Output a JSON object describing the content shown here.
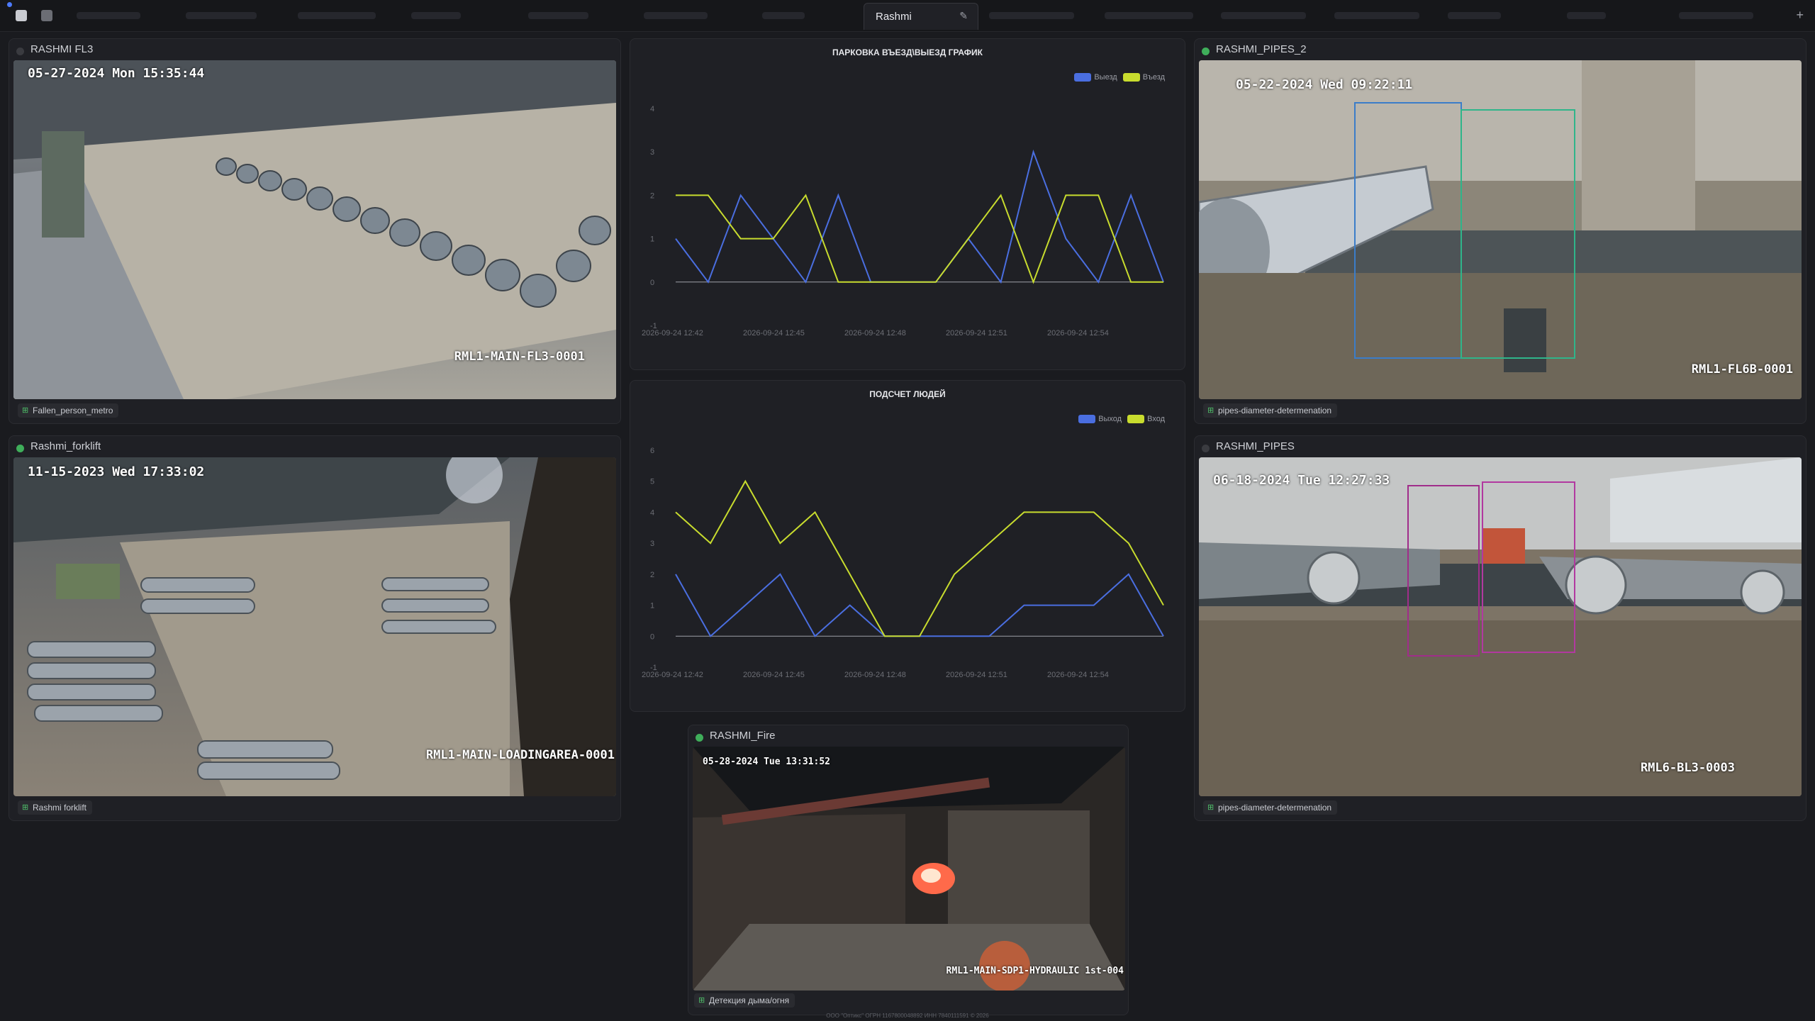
{
  "topbar": {
    "active_tab": "Rashmi"
  },
  "cameras": [
    {
      "title": "RASHMI FL3",
      "timestamp": "05-27-2024 Mon 15:35:44",
      "cam_id": "RML1-MAIN-FL3-0001",
      "tag": "Fallen_person_metro",
      "status": "offline",
      "status_color": "#3a3b40"
    },
    {
      "title": "Rashmi_forklift",
      "timestamp": "11-15-2023 Wed 17:33:02",
      "cam_id": "RML1-MAIN-LOADINGAREA-0001",
      "tag": "Rashmi forklift",
      "status": "online",
      "status_color": "#3fae5a"
    },
    {
      "title": "RASHMI_PIPES_2",
      "timestamp": "05-22-2024 Wed 09:22:11",
      "cam_id": "RML1-FL6B-0001",
      "tag": "pipes-diameter-determenation",
      "status": "online",
      "status_color": "#3fae5a"
    },
    {
      "title": "RASHMI_PIPES",
      "timestamp": "06-18-2024 Tue 12:27:33",
      "cam_id": "RML6-BL3-0003",
      "tag": "pipes-diameter-determenation",
      "status": "offline",
      "status_color": "#3a3b40"
    },
    {
      "title": "RASHMI_Fire",
      "timestamp": "05-28-2024 Tue 13:31:52",
      "cam_id": "RML1-MAIN-SDP1-HYDRAULIC 1st-004",
      "tag": "Детекция дыма/огня",
      "status": "online",
      "status_color": "#3fae5a"
    }
  ],
  "colors": {
    "blue": "#4a6ee0",
    "yellow": "#c8dc2e",
    "accent": "#4fbf6a"
  },
  "chart_data": [
    {
      "type": "line",
      "title": "ПАРКОВКА ВЪЕЗД\\ВЫЕЗД ГРАФИК",
      "x": [
        "2026-09-24 12:41",
        "2026-09-24 12:42",
        "2026-09-24 12:43",
        "2026-09-24 12:44",
        "2026-09-24 12:45",
        "2026-09-24 12:46",
        "2026-09-24 12:47",
        "2026-09-24 12:48",
        "2026-09-24 12:49",
        "2026-09-24 12:50",
        "2026-09-24 12:51",
        "2026-09-24 12:52",
        "2026-09-24 12:53",
        "2026-09-24 12:54",
        "2026-09-24 12:55"
      ],
      "tick_labels": [
        "2026-09-24 12:42",
        "2026-09-24 12:45",
        "2026-09-24 12:48",
        "2026-09-24 12:51",
        "2026-09-24 12:54"
      ],
      "ylim": [
        -1,
        4
      ],
      "yticks": [
        -1,
        0,
        1,
        2,
        3,
        4
      ],
      "series": [
        {
          "name": "Выезд",
          "color": "#4a6ee0",
          "values": [
            1,
            0,
            2,
            1,
            0,
            2,
            0,
            0,
            0,
            1,
            0,
            3,
            1,
            0,
            2,
            0
          ]
        },
        {
          "name": "Въезд",
          "color": "#c8dc2e",
          "values": [
            2,
            2,
            1,
            1,
            2,
            0,
            0,
            0,
            0,
            1,
            2,
            0,
            2,
            2,
            0,
            0
          ]
        }
      ],
      "legend": "top-right"
    },
    {
      "type": "line",
      "title": "ПОДСЧЕТ ЛЮДЕЙ",
      "x": [
        "2026-09-24 12:41",
        "2026-09-24 12:42",
        "2026-09-24 12:43",
        "2026-09-24 12:44",
        "2026-09-24 12:45",
        "2026-09-24 12:46",
        "2026-09-24 12:47",
        "2026-09-24 12:48",
        "2026-09-24 12:49",
        "2026-09-24 12:50",
        "2026-09-24 12:51",
        "2026-09-24 12:52",
        "2026-09-24 12:53",
        "2026-09-24 12:54",
        "2026-09-24 12:55"
      ],
      "tick_labels": [
        "2026-09-24 12:42",
        "2026-09-24 12:45",
        "2026-09-24 12:48",
        "2026-09-24 12:51",
        "2026-09-24 12:54"
      ],
      "ylim": [
        -1,
        6
      ],
      "yticks": [
        -1,
        0,
        1,
        2,
        3,
        4,
        5,
        6
      ],
      "series": [
        {
          "name": "Выход",
          "color": "#4a6ee0",
          "values": [
            2,
            0,
            1,
            2,
            0,
            1,
            0,
            0,
            0,
            0,
            1,
            1,
            1,
            2,
            0
          ]
        },
        {
          "name": "Вход",
          "color": "#c8dc2e",
          "values": [
            4,
            3,
            5,
            3,
            4,
            2,
            0,
            0,
            2,
            3,
            4,
            4,
            4,
            3,
            1
          ]
        }
      ],
      "legend": "top-right"
    }
  ],
  "footer": "ООО \"Оптикс\" ОГРН 1167800048892 ИНН 7840111591 © 2026"
}
